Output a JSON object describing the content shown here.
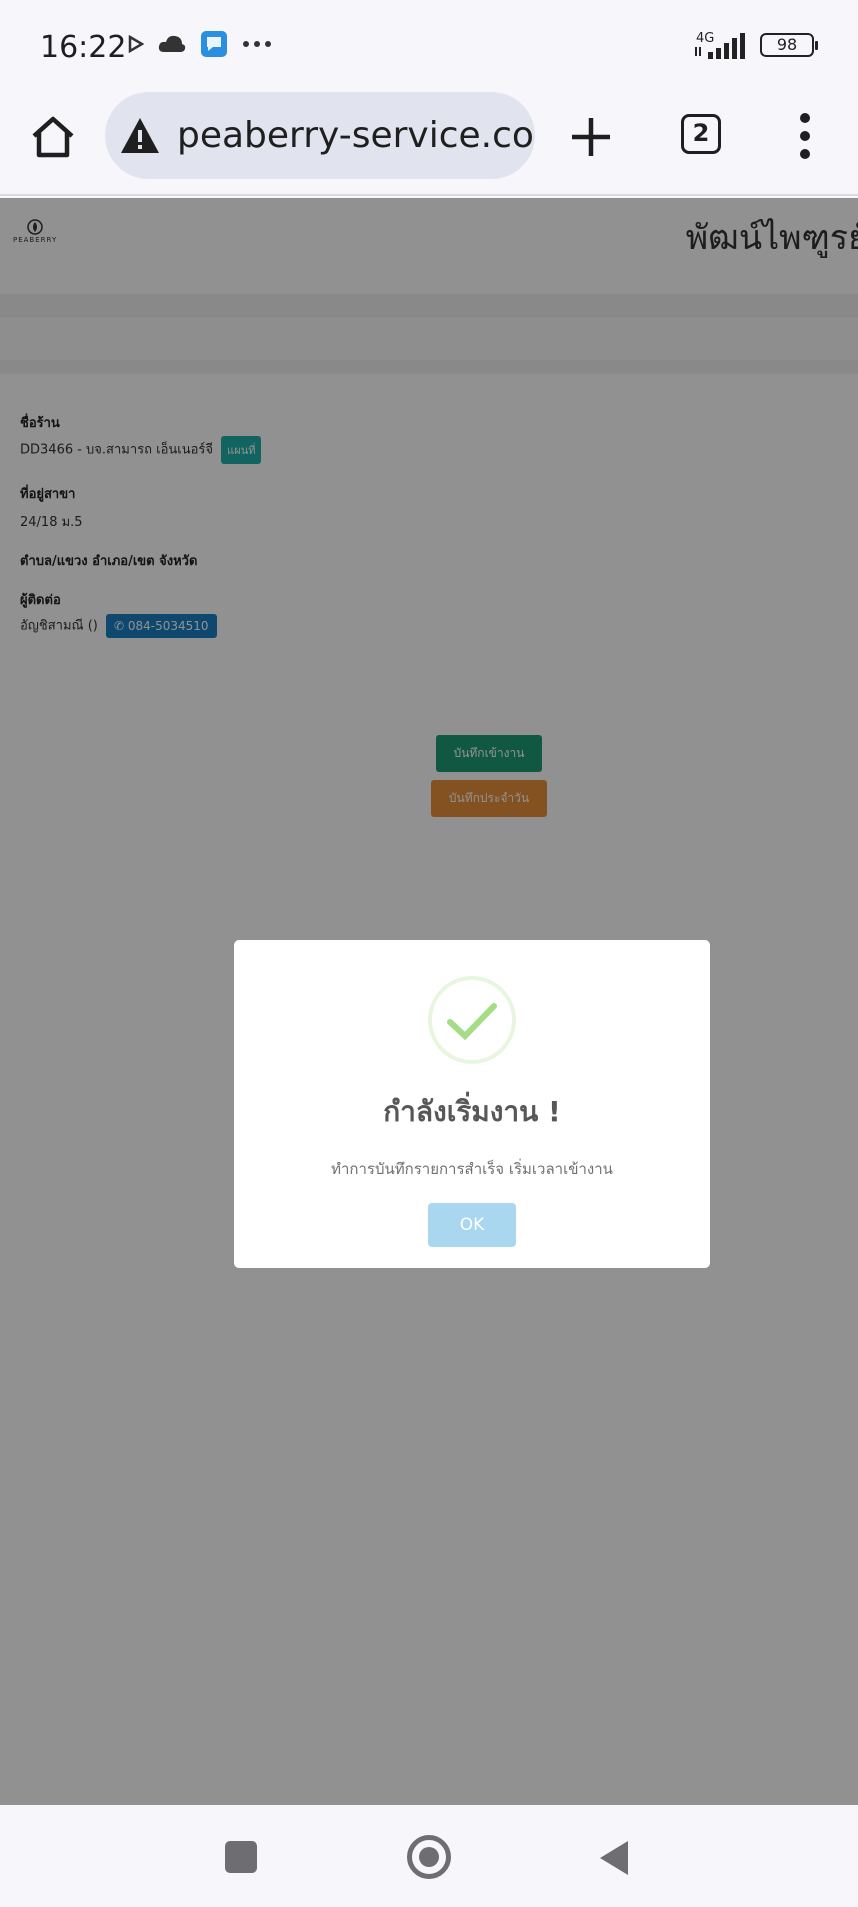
{
  "status_bar": {
    "time": "16:22",
    "network": "4G",
    "battery": "98",
    "left_icons": [
      "play-store-icon",
      "cloud-icon",
      "message-app-icon",
      "more-dots-icon"
    ]
  },
  "browser": {
    "url": "peaberry-service.com/",
    "tab_count": "2"
  },
  "site": {
    "logo_text": "PEABERRY",
    "header_title": "พัฒน์ไพฑูรย์"
  },
  "store_info": {
    "name_label": "ชื่อร้าน",
    "name_value": "DD3466 - บจ.สามารถ เอ็นเนอร์จี",
    "map_button": "แผนที่",
    "address_label": "ที่อยู่สาขา",
    "address_value": "24/18 ม.5",
    "district_label": "ตำบล/แขวง อำเภอ/เขต จังหวัด",
    "contact_label": "ผู้ติดต่อ",
    "contact_name": "อัญชิสามณี ()",
    "phone": "084-5034510"
  },
  "actions": {
    "checkin": "บันทึกเข้างาน",
    "daily": "บันทึกประจำวัน"
  },
  "modal": {
    "title": "กำลังเริ่มงาน !",
    "message": "ทำการบันทึกรายการสำเร็จ เริ่มเวลาเข้างาน",
    "ok": "OK",
    "icon_color": "#a5dc86"
  }
}
